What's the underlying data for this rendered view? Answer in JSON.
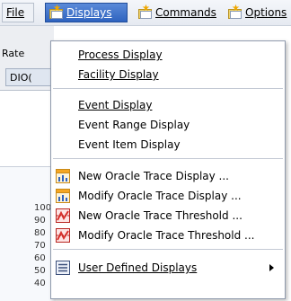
{
  "menubar": {
    "file": {
      "label": "File"
    },
    "displays": {
      "label": "Displays"
    },
    "commands": {
      "label": "Commands"
    },
    "options": {
      "label": "Options"
    }
  },
  "background": {
    "rate_label": "Rate",
    "tab_label": "DIO(",
    "y_ticks": [
      "100",
      "90",
      "80",
      "70",
      "60",
      "50",
      "40"
    ]
  },
  "dropdown": {
    "items": [
      {
        "label": "Process Display",
        "icon": ""
      },
      {
        "label": "Facility Display",
        "icon": ""
      },
      {
        "label": "Event Display",
        "icon": ""
      },
      {
        "label": "Event Range Display",
        "icon": ""
      },
      {
        "label": "Event Item Display",
        "icon": ""
      },
      {
        "label": "New Oracle Trace Display ...",
        "icon": "oracle-trace-display-icon"
      },
      {
        "label": "Modify Oracle Trace Display ...",
        "icon": "oracle-trace-display-icon"
      },
      {
        "label": "New Oracle Trace Threshold ...",
        "icon": "oracle-trace-threshold-icon"
      },
      {
        "label": "Modify Oracle Trace Threshold ...",
        "icon": "oracle-trace-threshold-icon"
      },
      {
        "label": "User Defined Displays",
        "icon": "list-icon",
        "submenu": true
      }
    ]
  },
  "colors": {
    "menu_highlight": "#3a6fcc",
    "chart_icon_orange": "#f5a623",
    "threshold_icon_red": "#d9302c"
  }
}
